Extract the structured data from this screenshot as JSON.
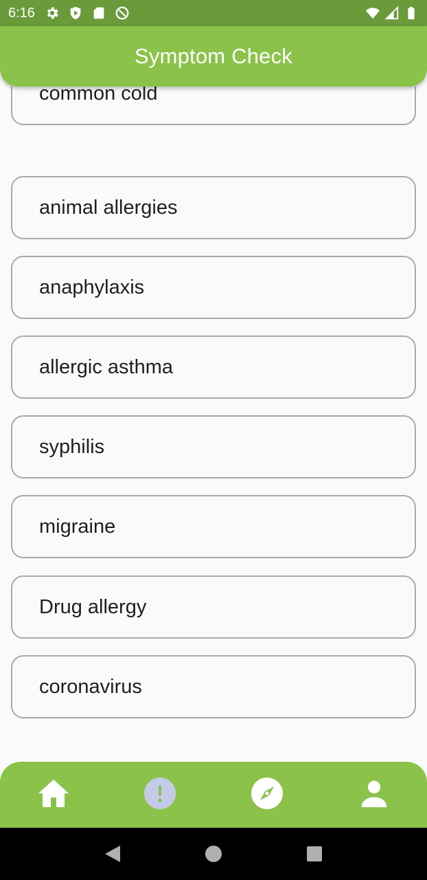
{
  "status_bar": {
    "time": "6:16",
    "left_icons": [
      "gear-icon",
      "shield-icon",
      "sd-card-icon",
      "at-icon"
    ],
    "right_icons": [
      "wifi-icon",
      "signal-icon",
      "battery-icon"
    ]
  },
  "app_bar": {
    "title": "Symptom Check",
    "color": "#8bc34a"
  },
  "conditions": [
    "common cold",
    "animal allergies",
    "anaphylaxis",
    "allergic asthma",
    "syphilis",
    "migraine",
    "Drug allergy",
    "coronavirus"
  ],
  "bottom_nav": {
    "items": [
      "home-icon",
      "alert-icon",
      "compass-icon",
      "person-icon"
    ],
    "selected": "alert-icon",
    "selected_color": "#c5cae9"
  },
  "system_nav": [
    "back-icon",
    "home-circle-icon",
    "recents-icon"
  ]
}
